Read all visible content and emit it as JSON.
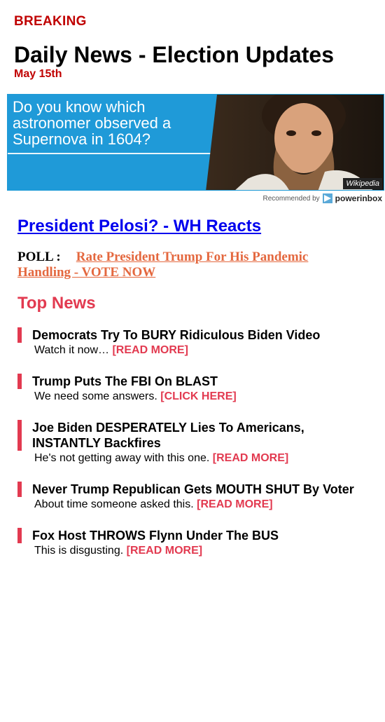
{
  "header": {
    "breaking": "BREAKING",
    "title": "Daily News - Election Updates",
    "date": "May 15th"
  },
  "ad": {
    "question": "Do you know which astronomer observed a Supernova in 1604?",
    "credit": "Wikipedia",
    "recommended_by": "Recommended by",
    "brand": "powerinbox",
    "colors": {
      "background": "#1f9ad8"
    }
  },
  "featured": {
    "headline": "President Pelosi? - WH Reacts"
  },
  "poll": {
    "label": "POLL :",
    "link_text": "Rate President Trump For His Pandemic Handling - VOTE NOW"
  },
  "top_news": {
    "heading": "Top News",
    "items": [
      {
        "title": "Democrats Try To BURY Ridiculous Biden Video",
        "sub": "Watch it now…",
        "more": "[READ MORE]"
      },
      {
        "title": "Trump Puts The FBI On BLAST",
        "sub": "We need some answers.",
        "more": "[CLICK HERE]"
      },
      {
        "title": "Joe Biden DESPERATELY Lies To Americans, INSTANTLY Backfires",
        "sub": "He's not getting away with this one.",
        "more": "[READ MORE]"
      },
      {
        "title": "Never Trump Republican Gets MOUTH SHUT By Voter",
        "sub": "About time someone asked this.",
        "more": "[READ MORE]"
      },
      {
        "title": "Fox Host THROWS Flynn Under The BUS",
        "sub": "This is disgusting.",
        "more": "[READ MORE]"
      }
    ]
  },
  "colors": {
    "accent": "#e23a50",
    "breaking": "#c00000",
    "poll_link": "#e4683f",
    "link": "#0000ee"
  }
}
